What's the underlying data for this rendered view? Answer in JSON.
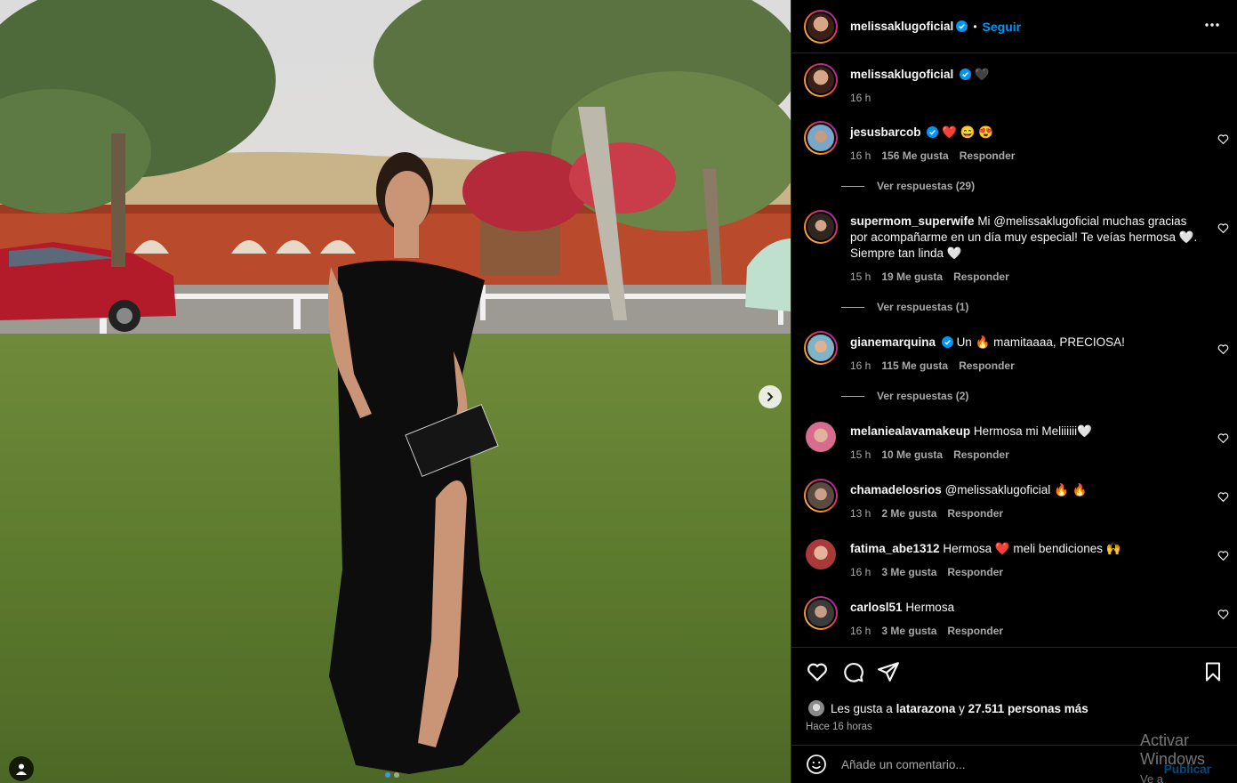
{
  "post": {
    "author": "melissaklugoficial",
    "follow_label": "Seguir",
    "separator": "•",
    "caption_emoji": "🖤",
    "caption_time": "16 h"
  },
  "comments": [
    {
      "user": "jesusbarcob",
      "verified": true,
      "text": "❤️ 😄 😍",
      "time": "16 h",
      "likes": "156 Me gusta",
      "reply": "Responder",
      "replies": "Ver respuestas (29)"
    },
    {
      "user": "supermom_superwife",
      "verified": false,
      "text": "Mi @melissaklugoficial muchas gracias por acompañarme en un día muy especial! Te veías hermosa 🤍. Siempre tan linda 🤍",
      "time": "15 h",
      "likes": "19 Me gusta",
      "reply": "Responder",
      "replies": "Ver respuestas (1)"
    },
    {
      "user": "gianemarquina",
      "verified": true,
      "text": "Un 🔥 mamitaaaa, PRECIOSA!",
      "time": "16 h",
      "likes": "115 Me gusta",
      "reply": "Responder",
      "replies": "Ver respuestas (2)"
    },
    {
      "user": "melaniealavamakeup",
      "verified": false,
      "text": "Hermosa mi Meliiiiii🤍",
      "time": "15 h",
      "likes": "10 Me gusta",
      "reply": "Responder"
    },
    {
      "user": "chamadelosrios",
      "verified": false,
      "text": "@melissaklugoficial 🔥 🔥",
      "time": "13 h",
      "likes": "2 Me gusta",
      "reply": "Responder"
    },
    {
      "user": "fatima_abe1312",
      "verified": false,
      "text": "Hermosa ❤️ meli bendiciones 🙌",
      "time": "16 h",
      "likes": "3 Me gusta",
      "reply": "Responder"
    },
    {
      "user": "carlosl51",
      "verified": false,
      "text": "Hermosa",
      "time": "16 h",
      "likes": "3 Me gusta",
      "reply": "Responder"
    }
  ],
  "footer": {
    "likes_prefix": "Les gusta a",
    "likes_user": "latarazona",
    "likes_and": "y",
    "likes_count": "27.511 personas más",
    "time_ago": "Hace 16 horas",
    "comment_placeholder": "Añade un comentario...",
    "publish_label": "Publicar"
  },
  "watermark": {
    "line1": "Activar Windows",
    "line2": "Ve a Configuración"
  },
  "icons": {
    "verified": "verified-badge-icon",
    "more": "more-horizontal-icon",
    "like": "heart-icon",
    "comment": "comment-icon",
    "share": "send-icon",
    "save": "bookmark-icon",
    "emoji": "emoji-icon",
    "next": "chevron-right-icon",
    "user_tag": "user-tag-icon"
  },
  "colors": {
    "accent": "#0095f6",
    "background": "#000000",
    "muted_text": "#a8a8a8"
  }
}
